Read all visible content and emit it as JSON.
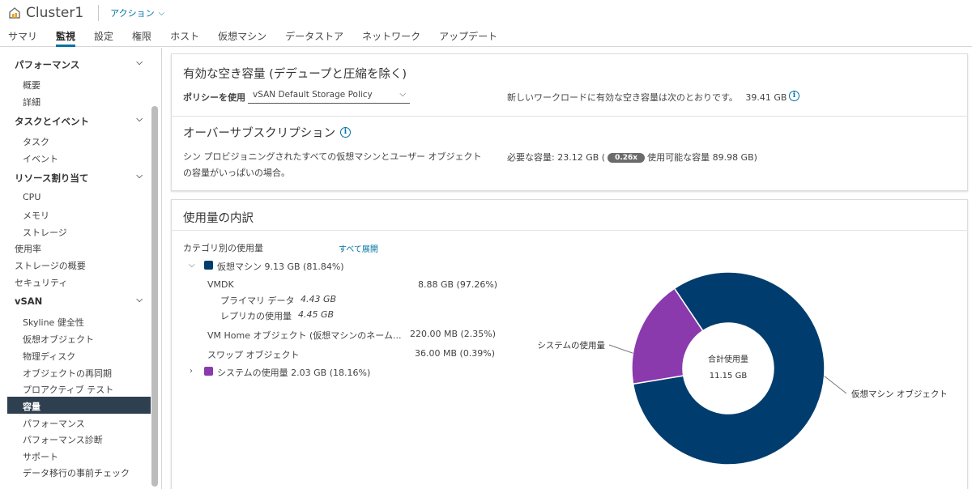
{
  "header": {
    "title": "Cluster1",
    "actions_label": "アクション",
    "tabs": [
      {
        "label": "サマリ",
        "active": false
      },
      {
        "label": "監視",
        "active": true
      },
      {
        "label": "設定",
        "active": false
      },
      {
        "label": "権限",
        "active": false
      },
      {
        "label": "ホスト",
        "active": false
      },
      {
        "label": "仮想マシン",
        "active": false
      },
      {
        "label": "データストア",
        "active": false
      },
      {
        "label": "ネットワーク",
        "active": false
      },
      {
        "label": "アップデート",
        "active": false
      }
    ]
  },
  "sidebar": {
    "performance_group": "パフォーマンス",
    "perf_overview": "概要",
    "perf_detail": "詳細",
    "tasks_group": "タスクとイベント",
    "tasks": "タスク",
    "events": "イベント",
    "resource_group": "リソース割り当て",
    "cpu": "CPU",
    "memory": "メモリ",
    "storage": "ストレージ",
    "utilization": "使用率",
    "storage_overview": "ストレージの概要",
    "security": "セキュリティ",
    "vsan_group": "vSAN",
    "skyline": "Skyline 健全性",
    "virtual_objects": "仮想オブジェクト",
    "physical_disks": "物理ディスク",
    "resync": "オブジェクトの再同期",
    "proactive": "プロアクティブ テスト",
    "capacity": "容量",
    "vsan_performance": "パフォーマンス",
    "perf_diagnostics": "パフォーマンス診断",
    "support": "サポート",
    "migration_check": "データ移行の事前チェック"
  },
  "free_capacity": {
    "title": "有効な空き容量 (デデュープと圧縮を除く)",
    "policy_label": "ポリシーを使用",
    "policy_value": "vSAN Default Storage Policy",
    "desc": "新しいワークロードに有効な空き容量は次のとおりです。",
    "value": "39.41 GB"
  },
  "oversubscription": {
    "title": "オーバーサブスクリプション",
    "desc_line1": "シン プロビジョニングされたすべての仮想マシンとユーザー オブジェクト",
    "desc_line2": "の容量がいっぱいの場合。",
    "required_prefix": "必要な容量: 23.12 GB (",
    "ratio": "0.26x",
    "available_suffix": "使用可能な容量 89.98 GB)"
  },
  "usage": {
    "title": "使用量の内訳",
    "category_label": "カテゴリ別の使用量",
    "expand_all": "すべて展開",
    "vm_row": "仮想マシン 9.13 GB (81.84%)",
    "vmdk_label": "VMDK",
    "vmdk_value": "8.88 GB (97.26%)",
    "primary_label": "プライマリ データ",
    "primary_value": "4.43 GB",
    "replica_label": "レプリカの使用量",
    "replica_value": "4.45 GB",
    "vmhome_label": "VM Home オブジェクト (仮想マシンのネーム...",
    "vmhome_value": "220.00 MB (2.35%)",
    "swap_label": "スワップ オブジェクト",
    "swap_value": "36.00 MB (0.39%)",
    "system_row": "システムの使用量 2.03 GB (18.16%)",
    "colors": {
      "vm": "#003d6e",
      "system": "#8a3aad"
    }
  },
  "chart_data": {
    "type": "pie",
    "center_label": "合計使用量",
    "center_value": "11.15 GB",
    "slices": [
      {
        "label": "仮想マシン オブジェクト",
        "value": 81.84,
        "color": "#003d6e"
      },
      {
        "label": "システムの使用量",
        "value": 18.16,
        "color": "#8a3aad"
      }
    ]
  }
}
